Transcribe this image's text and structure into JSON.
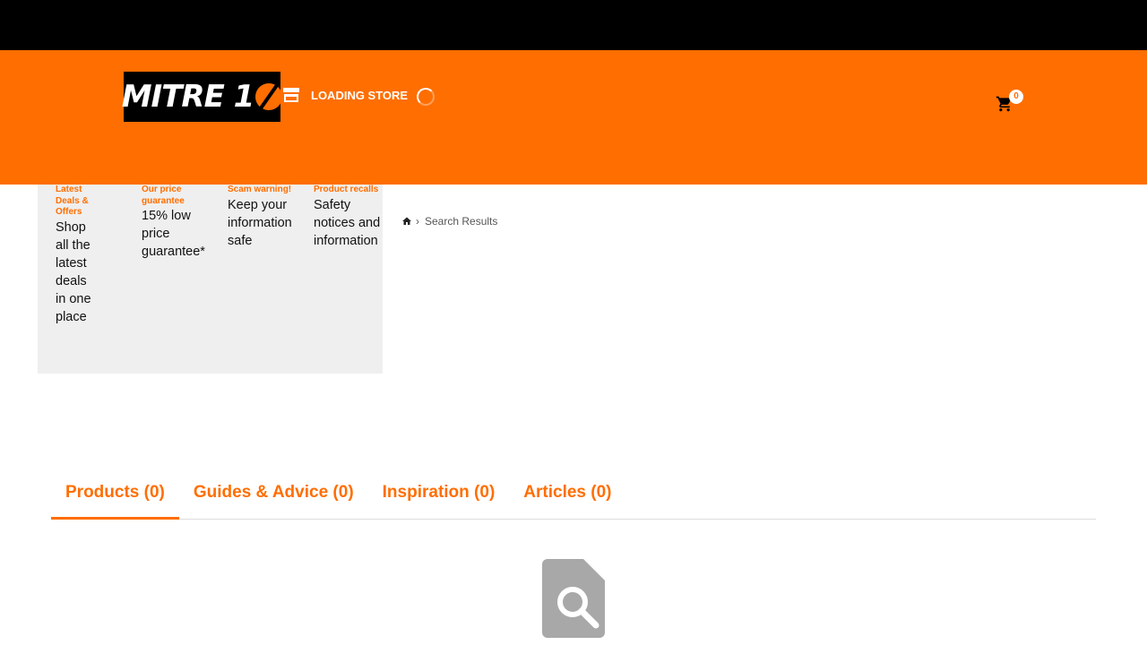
{
  "header": {
    "logo_text": "MITRE 1",
    "store_label": "LOADING STORE",
    "cart_count": "0",
    "brand_color": "#ff6e00"
  },
  "promo": {
    "items": [
      {
        "title": "Latest Deals & Offers",
        "body": "Shop all the latest deals in one place"
      },
      {
        "title": "Our price guarantee",
        "body": "15% low price guarantee*"
      },
      {
        "title": "Scam warning!",
        "body": "Keep your information safe"
      },
      {
        "title": "Product recalls",
        "body": "Safety notices and information"
      }
    ]
  },
  "breadcrumb": {
    "home_icon": "home-icon",
    "separator": "›",
    "current": "Search Results"
  },
  "tabs": [
    {
      "label": "Products (0)",
      "active": true
    },
    {
      "label": "Guides & Advice (0)",
      "active": false
    },
    {
      "label": "Inspiration (0)",
      "active": false
    },
    {
      "label": "Articles (0)",
      "active": false
    }
  ],
  "empty_state": {
    "icon": "document-search-icon"
  }
}
